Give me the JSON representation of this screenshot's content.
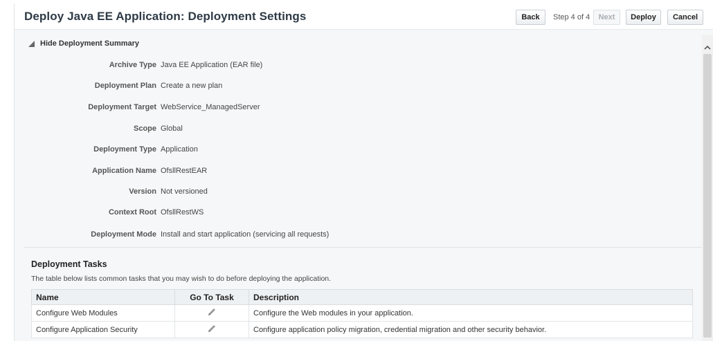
{
  "header": {
    "title": "Deploy Java EE Application: Deployment Settings",
    "back_label": "Back",
    "step_label": "Step 4 of 4",
    "next_label": "Next",
    "deploy_label": "Deploy",
    "cancel_label": "Cancel"
  },
  "summary": {
    "toggle_label": "Hide Deployment Summary",
    "rows": [
      {
        "label": "Archive Type",
        "value": "Java EE Application (EAR file)"
      },
      {
        "label": "Deployment Plan",
        "value": "Create a new plan"
      },
      {
        "label": "Deployment Target",
        "value": "WebService_ManagedServer"
      },
      {
        "label": "Scope",
        "value": "Global"
      },
      {
        "label": "Deployment Type",
        "value": "Application"
      },
      {
        "label": "Application Name",
        "value": "OfsllRestEAR"
      },
      {
        "label": "Version",
        "value": "Not versioned"
      },
      {
        "label": "Context Root",
        "value": "OfsllRestWS"
      },
      {
        "label": "Deployment Mode",
        "value": "Install and start application (servicing all requests)"
      }
    ]
  },
  "tasks": {
    "heading": "Deployment Tasks",
    "description": "The table below lists common tasks that you may wish to do before deploying the application.",
    "columns": [
      "Name",
      "Go To Task",
      "Description"
    ],
    "rows": [
      {
        "name": "Configure Web Modules",
        "go_icon": "pencil-icon",
        "description": "Configure the Web modules in your application."
      },
      {
        "name": "Configure Application Security",
        "go_icon": "pencil-icon",
        "description": "Configure application policy migration, credential migration and other security behavior."
      }
    ]
  },
  "colors": {
    "title": "#2e3a46",
    "header_bg": "#ffffff",
    "content_bg": "#f6f7f8",
    "table_header_bg": "#eef1f3",
    "disabled_text": "#a8aeb4"
  }
}
